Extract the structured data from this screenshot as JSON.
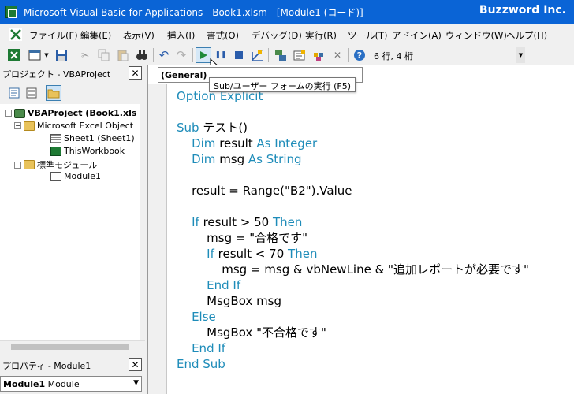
{
  "window": {
    "title": "Microsoft Visual Basic for Applications - Book1.xlsm - [Module1 (コード)]",
    "brand": "Buzzword Inc."
  },
  "menu": {
    "items": [
      "ファイル(F)",
      "編集(E)",
      "表示(V)",
      "挿入(I)",
      "書式(O)",
      "デバッグ(D)",
      "実行(R)",
      "ツール(T)",
      "アドイン(A)",
      "ウィンドウ(W)",
      "ヘルプ(H)"
    ]
  },
  "toolbar": {
    "status": "6 行, 4 桁",
    "tooltip": "Sub/ユーザー フォームの実行 (F5)"
  },
  "project_pane": {
    "caption": "プロジェクト - VBAProject",
    "tree": [
      {
        "label": "VBAProject (Book1.xls",
        "level": 0,
        "icon": "vbproject-icon",
        "bold": true
      },
      {
        "label": "Microsoft Excel Object",
        "level": 1,
        "icon": "folder-icon",
        "bold": false
      },
      {
        "label": "Sheet1 (Sheet1)",
        "level": 2,
        "icon": "sheet-icon",
        "bold": false
      },
      {
        "label": "ThisWorkbook",
        "level": 2,
        "icon": "workbook-icon",
        "bold": false
      },
      {
        "label": "標準モジュール",
        "level": 1,
        "icon": "folder-icon",
        "bold": false
      },
      {
        "label": "Module1",
        "level": 2,
        "icon": "module-icon",
        "bold": false
      }
    ]
  },
  "properties_pane": {
    "caption": "プロパティ - Module1",
    "object_name": "Module1",
    "object_type": "Module"
  },
  "code_window": {
    "procedure_dropdown": "(General)",
    "lines": [
      "Option Explicit",
      "",
      "Sub テスト()",
      "    Dim result As Integer",
      "    Dim msg As String",
      "",
      "    result = Range(\"B2\").Value",
      "",
      "    If result > 50 Then",
      "        msg = \"合格です\"",
      "        If result < 70 Then",
      "            msg = msg & vbNewLine & \"追加レポートが必要です\"",
      "        End If",
      "        MsgBox msg",
      "    Else",
      "        MsgBox \"不合格です\"",
      "    End If",
      "End Sub"
    ]
  },
  "colors": {
    "titlebar": "#0a64d6",
    "keyword": "#1e8cb9"
  }
}
